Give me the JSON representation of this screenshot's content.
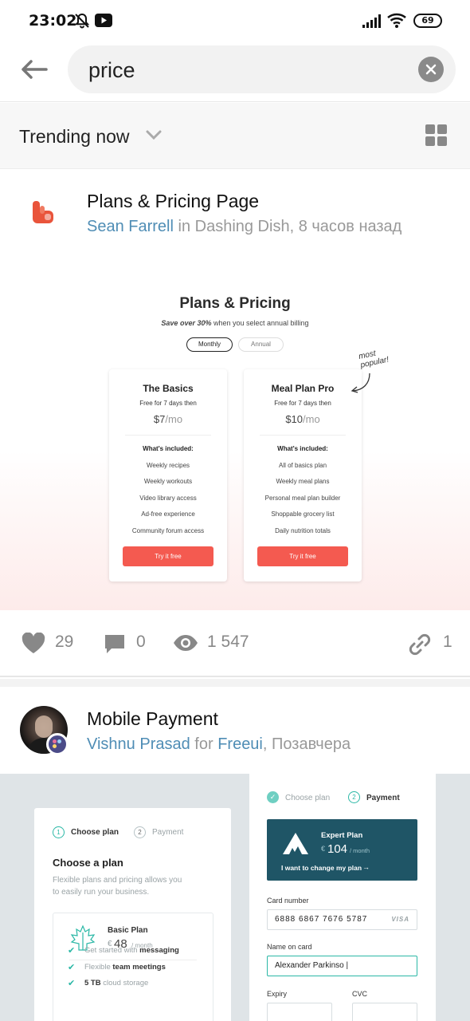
{
  "status_bar": {
    "time": "23:02",
    "battery": "69"
  },
  "search": {
    "query": "price"
  },
  "trending": {
    "label": "Trending now"
  },
  "post1": {
    "title": "Plans & Pricing Page",
    "author": "Sean Farrell",
    "in_word": " in ",
    "team": "Dashing Dish",
    "time": ", 8 часов назад",
    "shot": {
      "title": "Plans & Pricing",
      "subtitle_bold": "Save over 30%",
      "subtitle_rest": " when you select annual billing",
      "toggle_monthly": "Monthly",
      "toggle_annual": "Annual",
      "popular_note": "most popular!",
      "cards": [
        {
          "name": "The Basics",
          "free": "Free for 7 days then",
          "price": "$7",
          "per": "/mo",
          "included": "What's included:",
          "features": [
            "Weekly recipes",
            "Weekly workouts",
            "Video library access",
            "Ad-free experience",
            "Community forum access"
          ],
          "cta": "Try it free"
        },
        {
          "name": "Meal Plan Pro",
          "free": "Free for 7 days then",
          "price": "$10",
          "per": "/mo",
          "included": "What's included:",
          "features": [
            "All of basics plan",
            "Weekly meal plans",
            "Personal meal plan builder",
            "Shoppable grocery list",
            "Daily nutrition totals"
          ],
          "cta": "Try it free"
        }
      ]
    },
    "stats": {
      "likes": "29",
      "comments": "0",
      "views": "1 547",
      "links": "1"
    }
  },
  "post2": {
    "title": "Mobile Payment",
    "author": "Vishnu Prasad",
    "for_word": "for",
    "team": "Freeui",
    "time": ", Позавчера",
    "shot": {
      "step1_num": "1",
      "step1": "Choose plan",
      "step2_num": "2",
      "step2": "Payment",
      "heading": "Choose a plan",
      "desc_line1": "Flexible plans and pricing allows you",
      "desc_line2": "to easily run your business.",
      "basic_plan": "Basic Plan",
      "basic_currency": "€",
      "basic_price": "48",
      "basic_per": "/ month",
      "features": [
        {
          "pre": "Get started with ",
          "bold": "messaging",
          "post": ""
        },
        {
          "pre": "Flexible ",
          "bold": "team meetings",
          "post": ""
        },
        {
          "pre": "",
          "bold": "5 TB",
          "post": " cloud storage"
        }
      ],
      "expert_plan": "Expert Plan",
      "expert_currency": "€",
      "expert_price": "104",
      "expert_per": "/ month",
      "change_plan": "I want to change my plan",
      "card_label": "Card number",
      "card_value": "6888  6867  7676  5787",
      "card_brand": "VISA",
      "name_label": "Name on card",
      "name_value": "Alexander Parkinso |",
      "expiry_label": "Expiry",
      "cvc_label": "CVC"
    }
  },
  "colors": {
    "link": "#4f8db5",
    "cta": "#f45a50",
    "teal": "#2bb8a6",
    "panel": "#1f5566"
  }
}
